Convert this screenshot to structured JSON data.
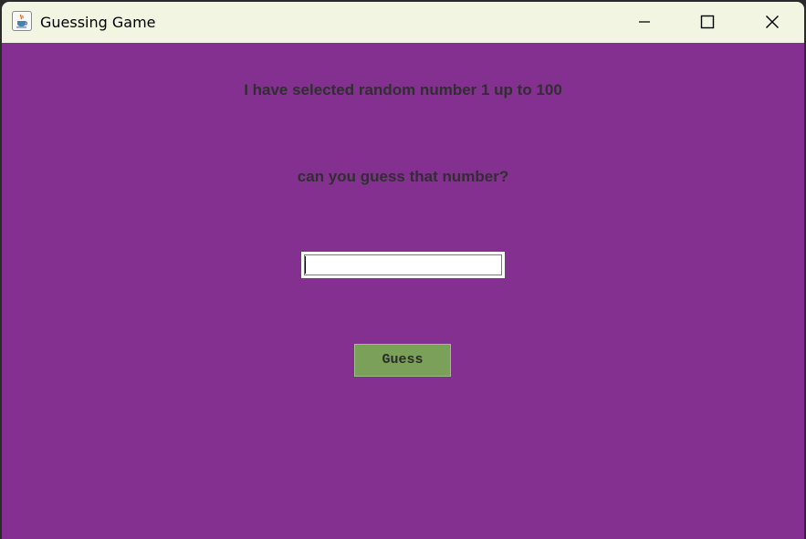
{
  "window": {
    "title": "Guessing Game",
    "icon": "java-cup-icon",
    "controls": {
      "minimize": "minimize-icon",
      "maximize": "maximize-icon",
      "close": "close-icon"
    }
  },
  "game": {
    "prompt_line_1": "I have selected random number 1 up to 100",
    "prompt_line_2": "can you guess that number?",
    "input_value": "",
    "guess_button_label": "Guess"
  },
  "colors": {
    "background": "#843090",
    "title_bar": "#f1f5e1",
    "button": "#7aa05a",
    "text": "#2f2f2f"
  }
}
